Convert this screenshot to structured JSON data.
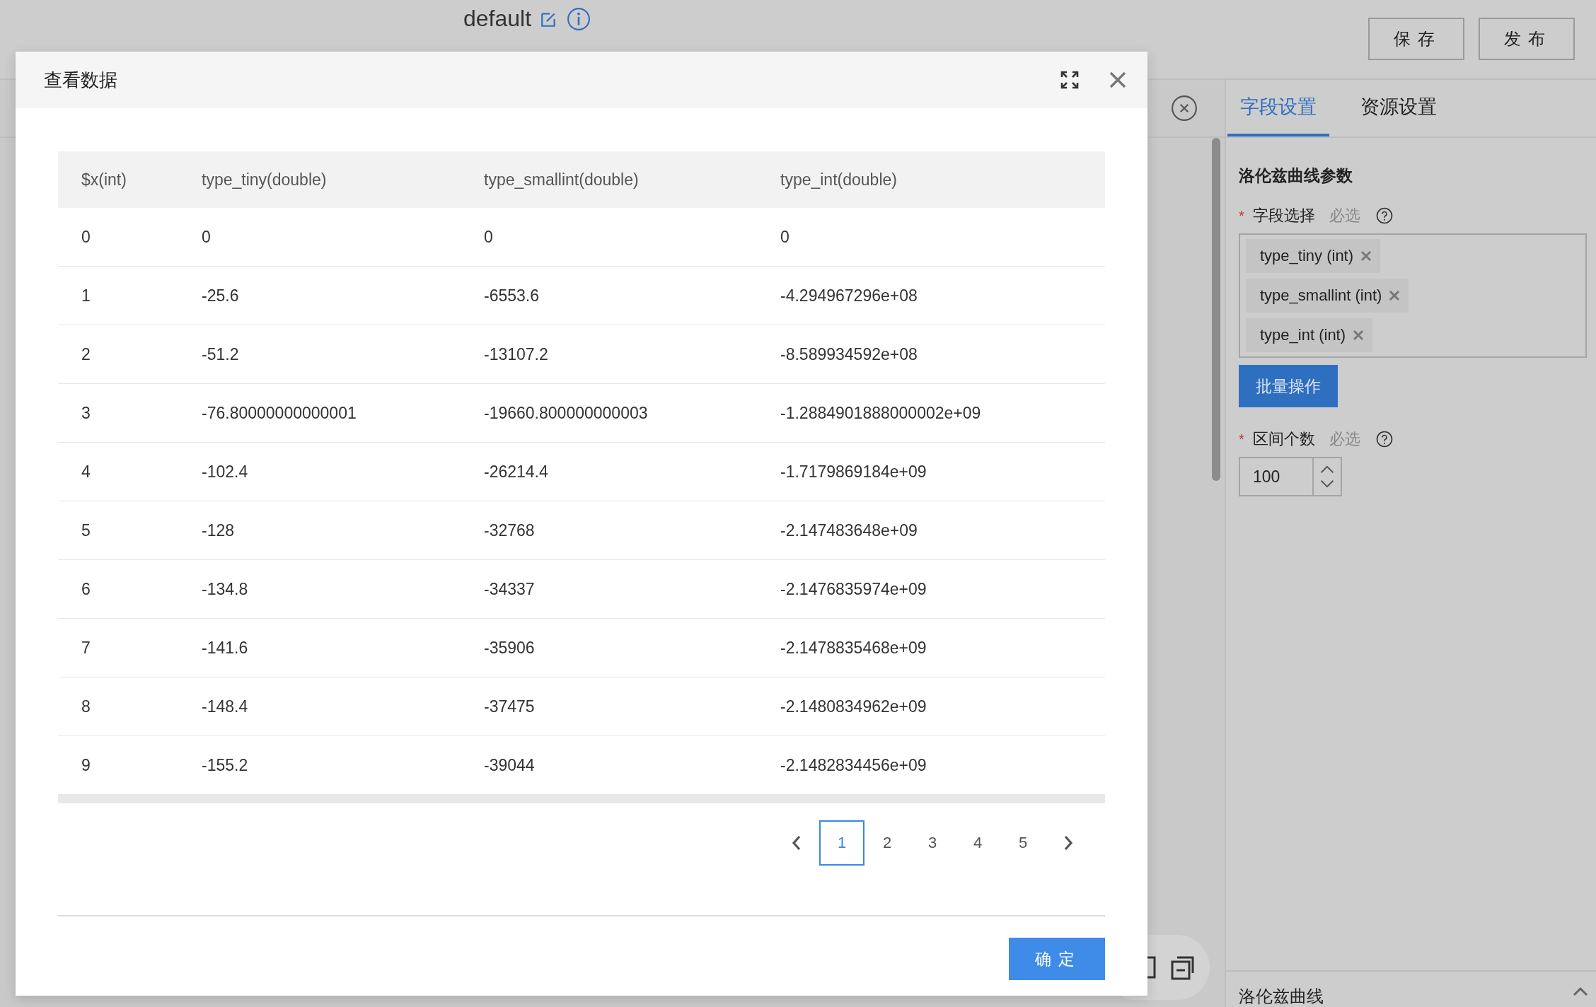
{
  "app": {
    "title": "default",
    "buttons": [
      "保存",
      "发布"
    ]
  },
  "right_panel": {
    "tabs": [
      {
        "label": "字段设置",
        "selected": true
      },
      {
        "label": "资源设置",
        "selected": false
      }
    ],
    "section_title": "洛伦兹曲线参数",
    "field_select": {
      "marker": "*",
      "label": "字段选择",
      "hint": "必选",
      "tags": [
        "type_tiny (int)",
        "type_smallint (int)",
        "type_int (int)"
      ]
    },
    "batch_button": "批量操作",
    "interval": {
      "marker": "*",
      "label": "区间个数",
      "hint": "必选",
      "value": "100"
    },
    "bottom_section": "洛伦兹曲线"
  },
  "modal": {
    "title": "查看数据",
    "table": {
      "columns": [
        "$x(int)",
        "type_tiny(double)",
        "type_smallint(double)",
        "type_int(double)"
      ],
      "rows": [
        [
          "0",
          "0",
          "0",
          "0"
        ],
        [
          "1",
          "-25.6",
          "-6553.6",
          "-4.294967296e+08"
        ],
        [
          "2",
          "-51.2",
          "-13107.2",
          "-8.589934592e+08"
        ],
        [
          "3",
          "-76.80000000000001",
          "-19660.800000000003",
          "-1.2884901888000002e+09"
        ],
        [
          "4",
          "-102.4",
          "-26214.4",
          "-1.7179869184e+09"
        ],
        [
          "5",
          "-128",
          "-32768",
          "-2.147483648e+09"
        ],
        [
          "6",
          "-134.8",
          "-34337",
          "-2.1476835974e+09"
        ],
        [
          "7",
          "-141.6",
          "-35906",
          "-2.1478835468e+09"
        ],
        [
          "8",
          "-148.4",
          "-37475",
          "-2.1480834962e+09"
        ],
        [
          "9",
          "-155.2",
          "-39044",
          "-2.1482834456e+09"
        ]
      ]
    },
    "pagination": [
      {
        "label": "1",
        "selected": true
      },
      {
        "label": "2",
        "selected": false
      },
      {
        "label": "3",
        "selected": false
      },
      {
        "label": "4",
        "selected": false
      },
      {
        "label": "5",
        "selected": false
      }
    ],
    "confirm_button": "确定"
  }
}
